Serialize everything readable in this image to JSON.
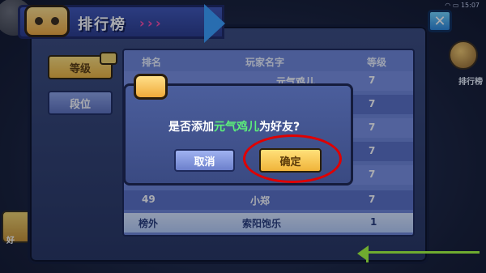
{
  "status_bar": {
    "time": "15:07"
  },
  "header": {
    "title": "排行榜",
    "close_symbol": "✕"
  },
  "side_hud": {
    "right_label": "排行榜",
    "left_label": "好"
  },
  "tabs": [
    {
      "label": "等级",
      "selected": true
    },
    {
      "label": "段位",
      "selected": false
    }
  ],
  "table": {
    "headers": {
      "rank": "排名",
      "player": "玩家名字",
      "level": "等级"
    },
    "rows": [
      {
        "rank": "",
        "player": "元气鸡儿",
        "level": "7"
      },
      {
        "rank": "",
        "player": "",
        "level": "7"
      },
      {
        "rank": "",
        "player": "",
        "level": "7"
      },
      {
        "rank": "",
        "player": "",
        "level": "7"
      },
      {
        "rank": "",
        "player": "",
        "level": "7"
      },
      {
        "rank": "49",
        "player": "小郑",
        "level": "7"
      }
    ],
    "self_row": {
      "rank": "榜外",
      "player": "索阳饱乐",
      "level": "1"
    }
  },
  "dialog": {
    "prefix": "是否添加",
    "highlight": "元气鸡儿",
    "suffix": "为好友?",
    "cancel_label": "取消",
    "confirm_label": "确定"
  },
  "colors": {
    "highlight": "#5df07a",
    "annotation_circle": "#e00000",
    "accent_arrow": "#a6ff3a"
  }
}
